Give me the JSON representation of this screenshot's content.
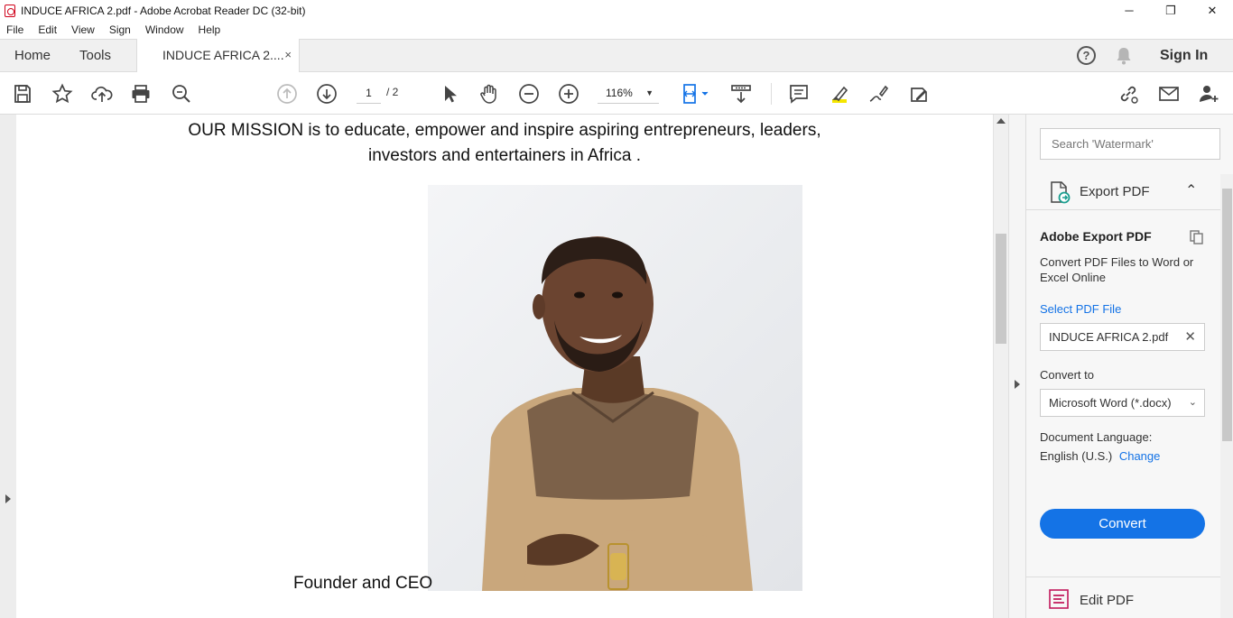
{
  "window": {
    "title": "INDUCE AFRICA 2.pdf - Adobe Acrobat Reader DC (32-bit)",
    "minimize": "─",
    "restore": "❐",
    "close": "✕"
  },
  "menu": [
    "File",
    "Edit",
    "View",
    "Sign",
    "Window",
    "Help"
  ],
  "tabs": {
    "home": "Home",
    "tools": "Tools",
    "document": "INDUCE AFRICA 2....",
    "close": "×",
    "sign_in": "Sign In",
    "help": "?"
  },
  "toolbar": {
    "page_current": "1",
    "page_total": "/ 2",
    "zoom": "116%",
    "zoom_caret": "▼"
  },
  "document": {
    "mission_line1": "OUR MISSION is to educate, empower and inspire aspiring entrepreneurs, leaders,",
    "mission_line2": "investors and entertainers in Africa .",
    "caption": "Founder and CEO"
  },
  "right_pane": {
    "search_placeholder": "Search 'Watermark'",
    "export_header": "Export PDF",
    "export_chevron": "⌃",
    "adobe_export_title": "Adobe Export PDF",
    "description": "Convert PDF Files to Word or Excel Online",
    "select_file": "Select PDF File",
    "file_name": "INDUCE AFRICA 2.pdf",
    "file_clear": "✕",
    "convert_to_label": "Convert to",
    "format": "Microsoft Word (*.docx)",
    "format_caret": "⌄",
    "doc_language_label": "Document Language:",
    "doc_language": "English (U.S.)",
    "change": "Change",
    "convert_button": "Convert",
    "edit_pdf": "Edit PDF"
  },
  "colors": {
    "accent": "#1473e6",
    "acrobat_red": "#d0021b",
    "highlight_yellow": "#f5e600"
  }
}
